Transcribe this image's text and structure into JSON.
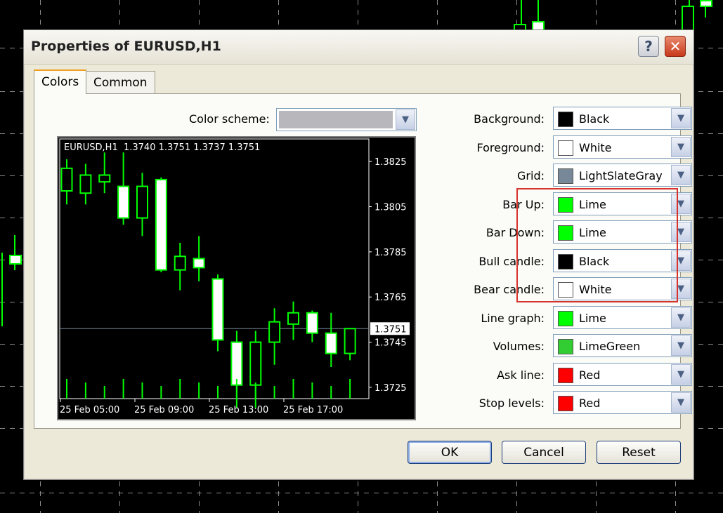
{
  "dialog": {
    "title": "Properties of EURUSD,H1",
    "help_label": "?",
    "close_label": "✕"
  },
  "tabs": [
    {
      "label": "Colors",
      "active": true
    },
    {
      "label": "Common",
      "active": false
    }
  ],
  "color_scheme": {
    "label": "Color scheme:",
    "value": ""
  },
  "preview_chart": {
    "symbol_header": "EURUSD,H1  1.3740 1.3751 1.3737 1.3751",
    "price_labels": [
      "1.3825",
      "1.3805",
      "1.3785",
      "1.3765",
      "1.3745",
      "1.3725"
    ],
    "current_price": "1.3751",
    "time_labels": [
      "25 Feb 05:00",
      "25 Feb 09:00",
      "25 Feb 13:00",
      "25 Feb 17:00"
    ]
  },
  "chart_data": {
    "type": "candlestick",
    "y_range": [
      1.372,
      1.3835
    ],
    "candles": [
      {
        "o": 1.3812,
        "h": 1.3826,
        "l": 1.3806,
        "c": 1.3822
      },
      {
        "o": 1.3811,
        "h": 1.3824,
        "l": 1.3806,
        "c": 1.3819
      },
      {
        "o": 1.3816,
        "h": 1.3829,
        "l": 1.3811,
        "c": 1.3819
      },
      {
        "o": 1.3814,
        "h": 1.3829,
        "l": 1.3797,
        "c": 1.38
      },
      {
        "o": 1.38,
        "h": 1.382,
        "l": 1.3792,
        "c": 1.3814
      },
      {
        "o": 1.3817,
        "h": 1.3818,
        "l": 1.3776,
        "c": 1.3777
      },
      {
        "o": 1.3777,
        "h": 1.3789,
        "l": 1.3768,
        "c": 1.3783
      },
      {
        "o": 1.3782,
        "h": 1.3792,
        "l": 1.3772,
        "c": 1.3778
      },
      {
        "o": 1.3773,
        "h": 1.3775,
        "l": 1.3741,
        "c": 1.3746
      },
      {
        "o": 1.3745,
        "h": 1.375,
        "l": 1.3716,
        "c": 1.3726
      },
      {
        "o": 1.3726,
        "h": 1.375,
        "l": 1.3716,
        "c": 1.3745
      },
      {
        "o": 1.3745,
        "h": 1.376,
        "l": 1.3735,
        "c": 1.3754
      },
      {
        "o": 1.3753,
        "h": 1.3763,
        "l": 1.3746,
        "c": 1.3758
      },
      {
        "o": 1.3758,
        "h": 1.3759,
        "l": 1.3745,
        "c": 1.3749
      },
      {
        "o": 1.3749,
        "h": 1.3758,
        "l": 1.3734,
        "c": 1.374
      },
      {
        "o": 1.374,
        "h": 1.3751,
        "l": 1.3737,
        "c": 1.3751
      }
    ]
  },
  "properties": [
    {
      "label": "Background:",
      "color_name": "Black",
      "color": "#000000"
    },
    {
      "label": "Foreground:",
      "color_name": "White",
      "color": "#ffffff"
    },
    {
      "label": "Grid:",
      "color_name": "LightSlateGray",
      "color": "#778899"
    },
    {
      "label": "Bar Up:",
      "color_name": "Lime",
      "color": "#00ff00"
    },
    {
      "label": "Bar Down:",
      "color_name": "Lime",
      "color": "#00ff00"
    },
    {
      "label": "Bull candle:",
      "color_name": "Black",
      "color": "#000000"
    },
    {
      "label": "Bear candle:",
      "color_name": "White",
      "color": "#ffffff"
    },
    {
      "label": "Line graph:",
      "color_name": "Lime",
      "color": "#00ff00"
    },
    {
      "label": "Volumes:",
      "color_name": "LimeGreen",
      "color": "#32cd32"
    },
    {
      "label": "Ask line:",
      "color_name": "Red",
      "color": "#ff0000"
    },
    {
      "label": "Stop levels:",
      "color_name": "Red",
      "color": "#ff0000"
    }
  ],
  "buttons": {
    "ok": "OK",
    "cancel": "Cancel",
    "reset": "Reset"
  },
  "colors": {
    "highlight": "#d8322c",
    "dialog_bg": "#ece9d8"
  }
}
